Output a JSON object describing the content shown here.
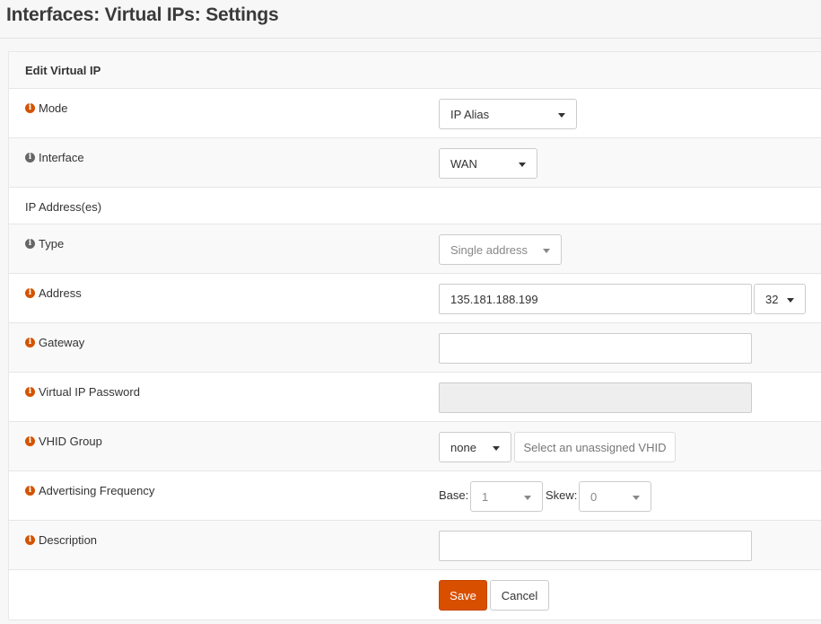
{
  "page": {
    "title": "Interfaces: Virtual IPs: Settings"
  },
  "panel": {
    "title": "Edit Virtual IP"
  },
  "fields": {
    "mode": {
      "label": "Mode",
      "value": "IP Alias"
    },
    "interface": {
      "label": "Interface",
      "value": "WAN"
    },
    "ip_section": {
      "label": "IP Address(es)"
    },
    "type": {
      "label": "Type",
      "value": "Single address"
    },
    "address": {
      "label": "Address",
      "value": "135.181.188.199",
      "mask": "32"
    },
    "gateway": {
      "label": "Gateway",
      "value": ""
    },
    "vip_password": {
      "label": "Virtual IP Password",
      "value": ""
    },
    "vhid": {
      "label": "VHID Group",
      "value": "none",
      "button": "Select an unassigned VHID"
    },
    "adv_freq": {
      "label": "Advertising Frequency",
      "base_label": "Base:",
      "base_value": "1",
      "skew_label": "Skew:",
      "skew_value": "0"
    },
    "description": {
      "label": "Description",
      "value": ""
    }
  },
  "actions": {
    "save": "Save",
    "cancel": "Cancel"
  },
  "colors": {
    "accent": "#d94f00",
    "info_icon": "#d35400"
  },
  "icons": {
    "info": "info-circle-icon",
    "caret": "caret-down-icon"
  }
}
